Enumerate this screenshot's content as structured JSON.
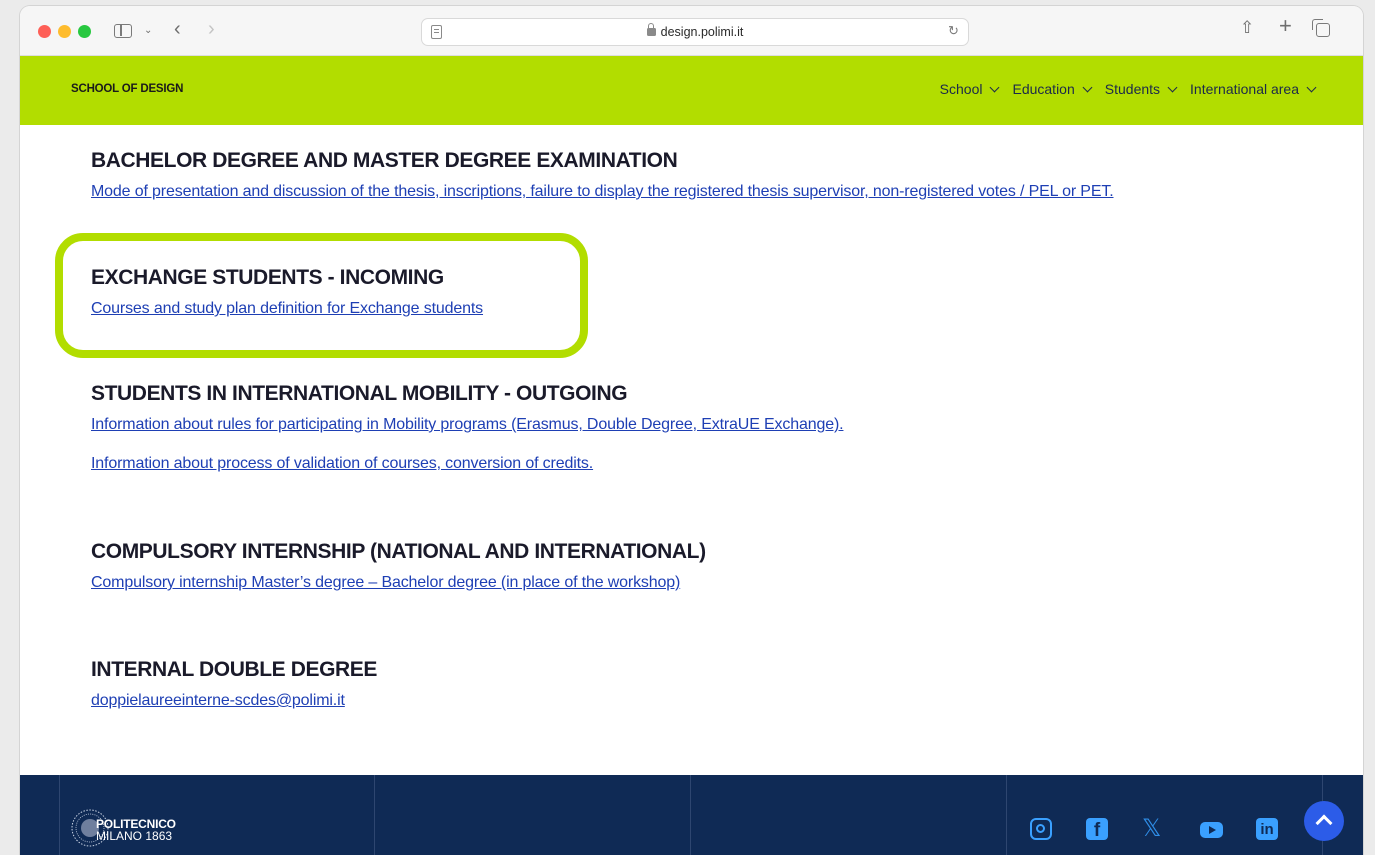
{
  "browser": {
    "url": "design.polimi.it"
  },
  "site": {
    "title": "SCHOOL OF DESIGN",
    "nav": [
      {
        "label": "School"
      },
      {
        "label": "Education"
      },
      {
        "label": "Students"
      },
      {
        "label": "International area"
      }
    ]
  },
  "sections": [
    {
      "heading": "BACHELOR DEGREE AND MASTER DEGREE EXAMINATION",
      "links": [
        "Mode of presentation and discussion of the thesis, inscriptions, failure to display the registered thesis supervisor, non-registered votes / PEL or PET."
      ]
    },
    {
      "heading": "EXCHANGE STUDENTS  - INCOMING",
      "links": [
        "Courses and study plan definition for Exchange students"
      ]
    },
    {
      "heading": "STUDENTS IN INTERNATIONAL MOBILITY - OUTGOING",
      "links": [
        "Information about rules for participating in Mobility programs (Erasmus, Double Degree, ExtraUE Exchange).",
        "Information about process of validation of courses, conversion of credits."
      ]
    },
    {
      "heading": "COMPULSORY INTERNSHIP (NATIONAL AND INTERNATIONAL)",
      "links": [
        "Compulsory internship Master’s degree – Bachelor degree (in place of the workshop)"
      ]
    },
    {
      "heading": "INTERNAL DOUBLE DEGREE",
      "links": [
        "doppielaureeinterne-scdes@polimi.it"
      ]
    }
  ],
  "footer": {
    "logo_line1": "POLITECNICO",
    "logo_line2": "MILANO 1863",
    "social_icons": [
      "instagram-icon",
      "facebook-icon",
      "x-icon",
      "youtube-icon",
      "linkedin-icon"
    ]
  },
  "colors": {
    "header_green": "#b2dd00",
    "link_blue": "#1e3fb4",
    "footer_navy": "#0f2a55",
    "social_blue": "#3aa0ff",
    "back_to_top_blue": "#2c5ce8"
  }
}
